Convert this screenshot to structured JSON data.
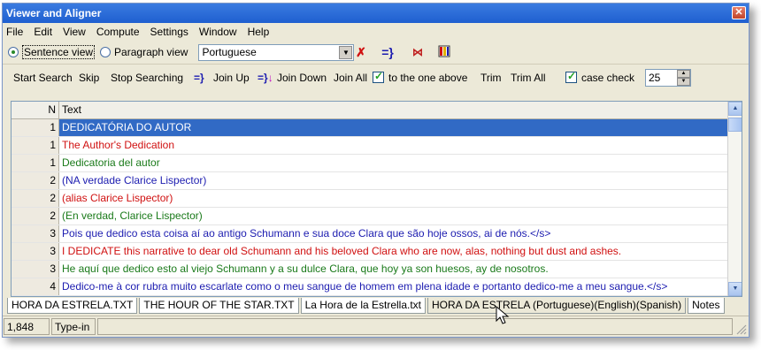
{
  "window": {
    "title": "Viewer and Aligner"
  },
  "menu": [
    "File",
    "Edit",
    "View",
    "Compute",
    "Settings",
    "Window",
    "Help"
  ],
  "view_mode": {
    "sentence_label": "Sentence view",
    "paragraph_label": "Paragraph view",
    "selected": "sentence"
  },
  "language_select": {
    "value": "Portuguese"
  },
  "toolbar2": {
    "start_search": "Start Search",
    "skip": "Skip",
    "stop_searching": "Stop Searching",
    "join_up": "Join Up",
    "join_down": "Join Down",
    "join_all": "Join All",
    "to_the_one_above": "to the one above",
    "trim": "Trim",
    "trim_all": "Trim All",
    "case_check": "case check",
    "spin_value": "25"
  },
  "grid": {
    "headers": {
      "n": "N",
      "text": "Text"
    },
    "rows": [
      {
        "n": "1",
        "text": "DEDICATÓRIA DO AUTOR",
        "lang": "pt",
        "selected": true
      },
      {
        "n": "1",
        "text": "The Author's Dedication",
        "lang": "en"
      },
      {
        "n": "1",
        "text": "Dedicatoria del autor",
        "lang": "es"
      },
      {
        "n": "2",
        "text": "(NA verdade Clarice Lispector)",
        "lang": "pt"
      },
      {
        "n": "2",
        "text": "(alias Clarice Lispector)",
        "lang": "en"
      },
      {
        "n": "2",
        "text": "(En verdad, Clarice Lispector)",
        "lang": "es"
      },
      {
        "n": "3",
        "text": "Pois que dedico esta coisa aí ao antigo Schumann e sua doce Clara que são hoje ossos, ai de nós.</s>",
        "lang": "pt"
      },
      {
        "n": "3",
        "text": "I DEDICATE this narrative to dear old Schumann and his beloved Clara who are now, alas, nothing but dust and ashes.",
        "lang": "en"
      },
      {
        "n": "3",
        "text": "He aquí que dedico esto al viejo Schumann y a su dulce Clara, que hoy ya son huesos, ay de nosotros.",
        "lang": "es"
      },
      {
        "n": "4",
        "text": "Dedico-me à cor rubra muito escarlate como o meu sangue de homem em plena idade e portanto dedico-me a meu sangue.</s>",
        "lang": "pt"
      }
    ]
  },
  "tabs": [
    {
      "label": "HORA DA ESTRELA.TXT"
    },
    {
      "label": "THE HOUR OF THE STAR.TXT"
    },
    {
      "label": "La Hora de la Estrella.txt"
    },
    {
      "label": "HORA DA ESTRELA (Portuguese)(English)(Spanish)",
      "active": true
    },
    {
      "label": "Notes"
    }
  ],
  "status": {
    "count": "1,848",
    "mode": "Type-in"
  },
  "colors": {
    "pt": "#1c1cb0",
    "en": "#d01010",
    "es": "#1a7a1a",
    "selection": "#316ac5",
    "title": "#1f5fd0"
  }
}
